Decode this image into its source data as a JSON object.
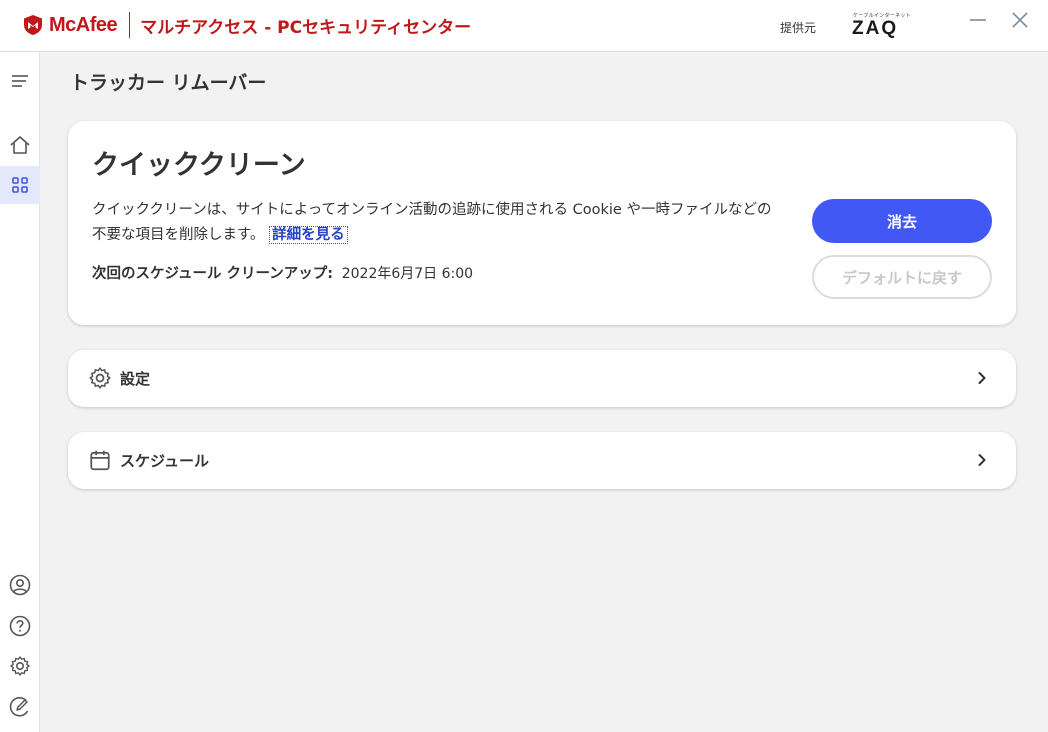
{
  "window": {
    "brand_name": "McAfee",
    "product_title": "マルチアクセス - PCセキュリティセンター",
    "provider_label": "提供元",
    "provider_logo_top": "ケーブルインターネット",
    "provider_logo_word": "ZAQ",
    "minimize_icon": "minimize-icon",
    "close_icon": "close-icon",
    "brand_color": "#c01818"
  },
  "sidebar": {
    "top_items": [
      {
        "icon": "menu-icon"
      },
      {
        "icon": "home-icon"
      },
      {
        "icon": "apps-grid-icon",
        "active": true
      }
    ],
    "bottom_items": [
      {
        "icon": "account-icon"
      },
      {
        "icon": "help-icon"
      },
      {
        "icon": "settings-icon"
      },
      {
        "icon": "feedback-icon"
      }
    ],
    "active_color": "#e4e8fb"
  },
  "page": {
    "title": "トラッカー リムーバー"
  },
  "quick_clean": {
    "title": "クイッククリーン",
    "description": "クイッククリーンは、サイトによってオンライン活動の追跡に使用される Cookie や一時ファイルなどの不要な項目を削除します。",
    "learn_more": "詳細を見る",
    "schedule_label": "次回のスケジュール クリーンアップ:",
    "schedule_value": "2022年6月7日 6:00",
    "primary_button": "消去",
    "secondary_button": "デフォルトに戻す",
    "accent_color": "#4258f5"
  },
  "rows": {
    "settings_label": "設定",
    "schedule_label": "スケジュール"
  }
}
